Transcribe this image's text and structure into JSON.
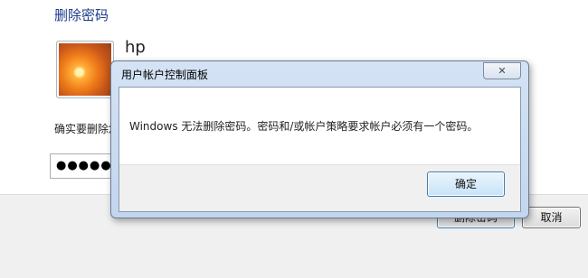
{
  "background_window": {
    "title": "删除密码",
    "username": "hp",
    "confirm_text": "确实要删除您的密码吗?",
    "password_value": "●●●●●●●●●",
    "remove_button": "删除密码",
    "cancel_button": "取消"
  },
  "dialog": {
    "title": "用户帐户控制面板",
    "close_glyph": "✕",
    "message": "Windows 无法删除密码。密码和/或帐户策略要求帐户必须有一个密码。",
    "ok_button": "确定"
  }
}
